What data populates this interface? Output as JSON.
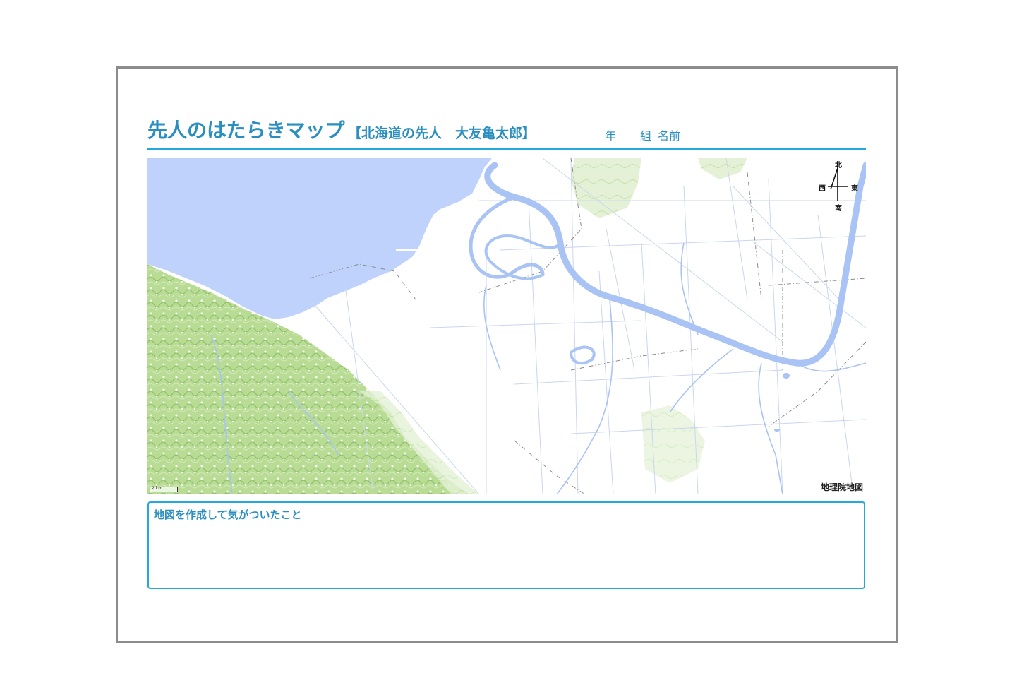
{
  "worksheet": {
    "title": "先人のはたらきマップ",
    "subtitle": "【北海道の先人　大友亀太郎】",
    "grade_label": "年",
    "class_label": "組",
    "name_label": "名前"
  },
  "map": {
    "compass": {
      "north": "北",
      "south": "南",
      "west": "西",
      "east": "東"
    },
    "scale_label": "2 km",
    "attribution": "地理院地図",
    "colors": {
      "water": "#bed2fb",
      "river": "#a9c3f4",
      "forest": "#a7cf82",
      "forest_dark": "#7fb65a",
      "road": "#c9d6ee",
      "boundary": "#8a8a8a"
    }
  },
  "notes": {
    "label": "地図を作成して気がついたこと"
  }
}
